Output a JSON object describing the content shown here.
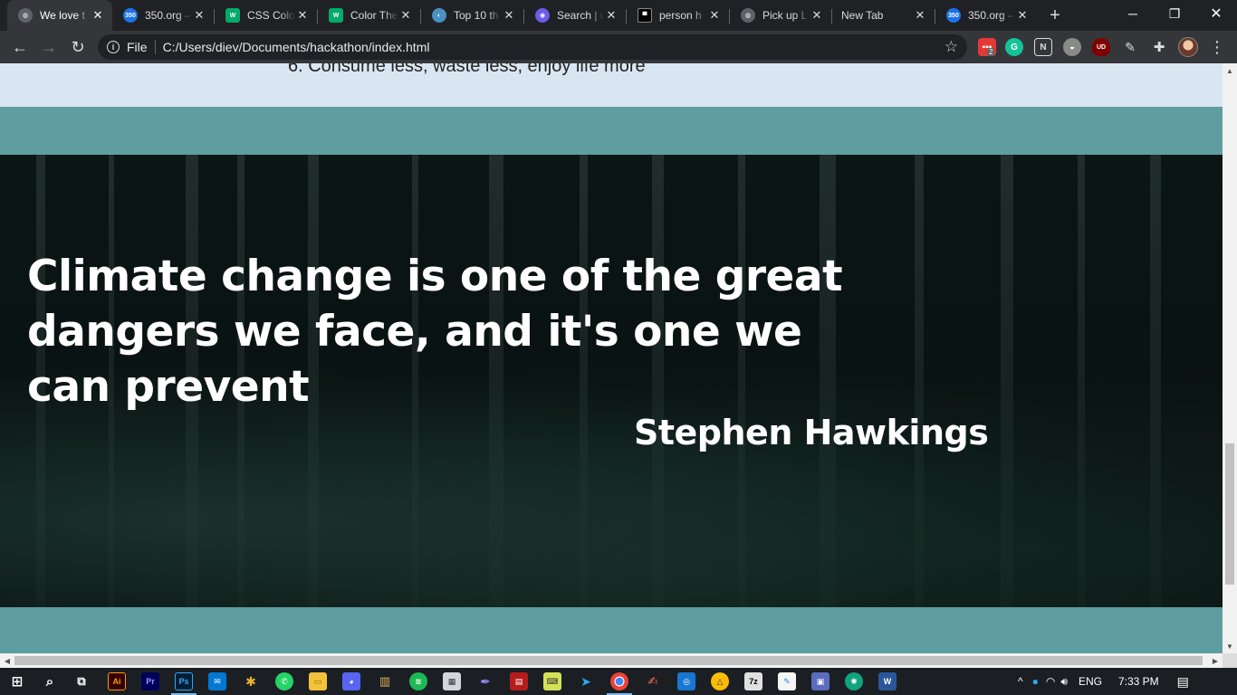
{
  "browser": {
    "tabs": [
      {
        "title": "We love t",
        "icon": "globe-icon",
        "color": "#5f6368",
        "active": true
      },
      {
        "title": "350.org –",
        "icon": "350-logo-icon",
        "color": "#1a73e8",
        "active": false
      },
      {
        "title": "CSS Colo",
        "icon": "w3schools-icon",
        "color": "#04aa6d",
        "active": false
      },
      {
        "title": "Color The",
        "icon": "w3schools-icon",
        "color": "#04aa6d",
        "active": false
      },
      {
        "title": "Top 10 th",
        "icon": "planet-icon",
        "color": "#4a90c2",
        "active": false
      },
      {
        "title": "Search | u",
        "icon": "search-site-icon",
        "color": "#6c5ce7",
        "active": false
      },
      {
        "title": "person h",
        "icon": "unsplash-icon",
        "color": "#000000",
        "active": false
      },
      {
        "title": "Pick up L",
        "icon": "globe-icon",
        "color": "#5f6368",
        "active": false
      },
      {
        "title": "New Tab",
        "icon": "",
        "color": "",
        "active": false
      },
      {
        "title": "350.org –",
        "icon": "350-logo-icon",
        "color": "#1a73e8",
        "active": false
      }
    ],
    "url_scheme": "File",
    "url": "C:/Users/diev/Documents/hackathon/index.html",
    "extension_badge": "2"
  },
  "page": {
    "list_item_partial": "6. Consume less, waste less, enjoy life more",
    "quote": "Climate change is one of the great dangers we face, and it's one we can prevent",
    "quote_author": "Stephen Hawkings"
  },
  "taskbar": {
    "language": "ENG",
    "time": "7:33 PM"
  },
  "colors": {
    "list_band": "#dae5f2",
    "teal": "#5f9ea0",
    "chrome_dark": "#202124",
    "chrome_toolbar": "#35363a"
  }
}
